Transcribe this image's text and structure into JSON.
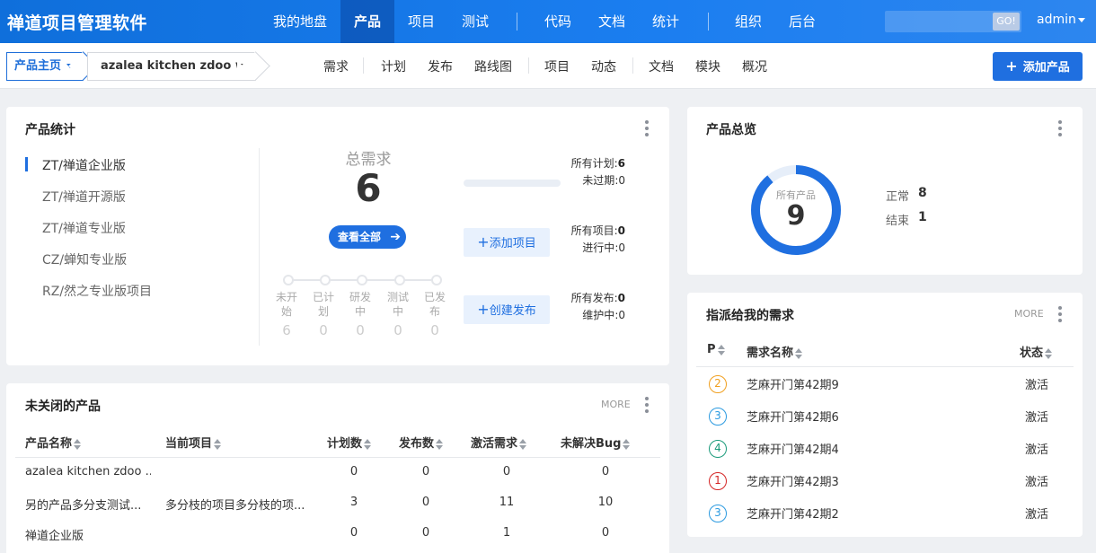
{
  "app": {
    "logo": "禅道项目管理软件",
    "user": "admin"
  },
  "topnav": {
    "items": [
      {
        "label": "我的地盘",
        "active": false
      },
      {
        "label": "产品",
        "active": true
      },
      {
        "label": "项目",
        "active": false
      },
      {
        "label": "测试",
        "active": false
      },
      {
        "label": "代码",
        "active": false
      },
      {
        "label": "文档",
        "active": false
      },
      {
        "label": "统计",
        "active": false
      },
      {
        "label": "组织",
        "active": false
      },
      {
        "label": "后台",
        "active": false
      }
    ],
    "search": {
      "placeholder": "",
      "go_label": "GO!"
    }
  },
  "subbar": {
    "crumb_home": "产品主页",
    "crumb_product": "azalea kitchen zdoo wo...",
    "items": [
      "需求",
      "计划",
      "发布",
      "路线图",
      "项目",
      "动态",
      "文档",
      "模块",
      "概况"
    ],
    "add_product": "添加产品"
  },
  "stats": {
    "title": "产品统计",
    "products": [
      "ZT/禅道企业版",
      "ZT/禅道开源版",
      "ZT/禅道专业版",
      "CZ/蝉知专业版",
      "RZ/然之专业版项目"
    ],
    "active_index": 0,
    "total_label": "总需求",
    "total_value": "6",
    "view_all": "查看全部",
    "stages": [
      {
        "label": "未开始",
        "value": "6"
      },
      {
        "label": "已计划",
        "value": "0"
      },
      {
        "label": "研发中",
        "value": "0"
      },
      {
        "label": "测试中",
        "value": "0"
      },
      {
        "label": "已发布",
        "value": "0"
      }
    ],
    "plans": {
      "all_label": "所有计划",
      "all_value": "6",
      "unexpired_label": "未过期",
      "unexpired_value": "0"
    },
    "add_project": "添加项目",
    "projects": {
      "all_label": "所有项目",
      "all_value": "0",
      "doing_label": "进行中",
      "doing_value": "0"
    },
    "create_release": "创建发布",
    "releases": {
      "all_label": "所有发布",
      "all_value": "0",
      "maint_label": "维护中",
      "maint_value": "0"
    }
  },
  "overview": {
    "title": "产品总览",
    "ring_label": "所有产品",
    "ring_value": "9",
    "normal_label": "正常",
    "normal_value": "8",
    "closed_label": "结束",
    "closed_value": "1",
    "ring_color": "#1f6fe0"
  },
  "assigned": {
    "title": "指派给我的需求",
    "more": "MORE",
    "headers": {
      "p": "P",
      "name": "需求名称",
      "status": "状态"
    },
    "rows": [
      {
        "pri": "2",
        "color": "#f0a020",
        "name": "芝麻开门第42期9",
        "status": "激活"
      },
      {
        "pri": "3",
        "color": "#2b9ae0",
        "name": "芝麻开门第42期6",
        "status": "激活"
      },
      {
        "pri": "4",
        "color": "#1a9a7a",
        "name": "芝麻开门第42期4",
        "status": "激活"
      },
      {
        "pri": "1",
        "color": "#d42525",
        "name": "芝麻开门第42期3",
        "status": "激活"
      },
      {
        "pri": "3",
        "color": "#2b9ae0",
        "name": "芝麻开门第42期2",
        "status": "激活"
      }
    ]
  },
  "unclosed": {
    "title": "未关闭的产品",
    "more": "MORE",
    "headers": [
      "产品名称",
      "当前项目",
      "计划数",
      "发布数",
      "激活需求",
      "未解决Bug"
    ],
    "rows": [
      {
        "name": "azalea kitchen zdoo ...",
        "project": "",
        "plans": "0",
        "releases": "0",
        "stories": "0",
        "bugs": "0"
      },
      {
        "name": "另的产品多分支测试...",
        "project": "多分枝的项目多分枝的项...",
        "plans": "3",
        "releases": "0",
        "stories": "11",
        "bugs": "10"
      },
      {
        "name": "禅道企业版",
        "project": "",
        "plans": "0",
        "releases": "0",
        "stories": "1",
        "bugs": "0"
      }
    ]
  }
}
